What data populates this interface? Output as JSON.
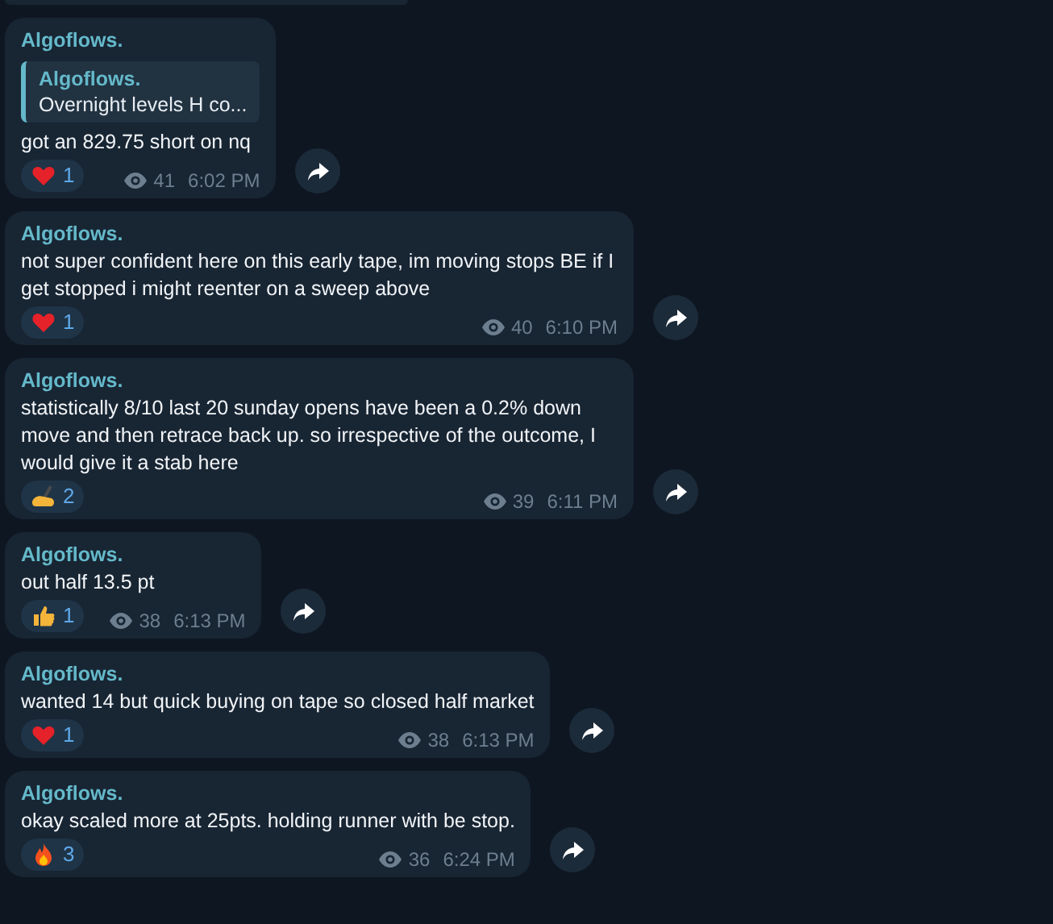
{
  "messages": [
    {
      "author": "Algoflows.",
      "reply": {
        "author": "Algoflows.",
        "text": "Overnight levels H co..."
      },
      "text": "got an 829.75 short on nq",
      "reaction": {
        "kind": "heart",
        "count": "1"
      },
      "views": "41",
      "time": "6:02 PM"
    },
    {
      "author": "Algoflows.",
      "text": "not super confident here on this early tape, im moving stops BE if I get stopped i might reenter on a sweep above",
      "reaction": {
        "kind": "heart",
        "count": "1"
      },
      "views": "40",
      "time": "6:10 PM"
    },
    {
      "author": "Algoflows.",
      "text": "statistically 8/10 last 20 sunday opens have been a 0.2% down move and then retrace back up. so irrespective of the outcome, I would give it a stab here",
      "reaction": {
        "kind": "writing",
        "count": "2"
      },
      "views": "39",
      "time": "6:11 PM"
    },
    {
      "author": "Algoflows.",
      "text": "out half 13.5 pt",
      "reaction": {
        "kind": "thumbs",
        "count": "1"
      },
      "views": "38",
      "time": "6:13 PM"
    },
    {
      "author": "Algoflows.",
      "text": "wanted 14 but quick buying on tape so closed half market",
      "reaction": {
        "kind": "heart",
        "count": "1"
      },
      "views": "38",
      "time": "6:13 PM"
    },
    {
      "author": "Algoflows.",
      "text": "okay scaled more at 25pts. holding runner with be stop.",
      "reaction": {
        "kind": "fire",
        "count": "3"
      },
      "views": "36",
      "time": "6:24 PM"
    }
  ]
}
